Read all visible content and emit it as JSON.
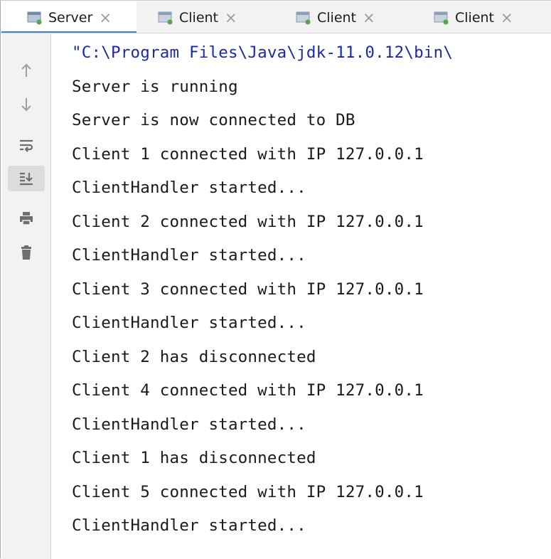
{
  "tabs": [
    {
      "label": "Server",
      "active": true
    },
    {
      "label": "Client",
      "active": false
    },
    {
      "label": "Client",
      "active": false
    },
    {
      "label": "Client",
      "active": false
    }
  ],
  "close_glyph": "×",
  "toolbar": {
    "icons": [
      "up-arrow-icon",
      "down-arrow-icon",
      "soft-wrap-icon",
      "scroll-to-end-icon",
      "print-icon",
      "trash-icon"
    ]
  },
  "console": {
    "lines": [
      "\"C:\\Program Files\\Java\\jdk-11.0.12\\bin\\",
      "Server is running",
      "Server is now connected to DB",
      "Client 1 connected with IP 127.0.0.1",
      "ClientHandler started...",
      "Client 2 connected with IP 127.0.0.1",
      "ClientHandler started...",
      "Client 3 connected with IP 127.0.0.1",
      "ClientHandler started...",
      "Client 2 has disconnected",
      "Client 4 connected with IP 127.0.0.1",
      "ClientHandler started...",
      "Client 1 has disconnected",
      "Client 5 connected with IP 127.0.0.1",
      "ClientHandler started..."
    ]
  },
  "colors": {
    "accent": "#4083c9",
    "command_text": "#1b2aa6",
    "tab_icon_green": "#5aa34a"
  }
}
